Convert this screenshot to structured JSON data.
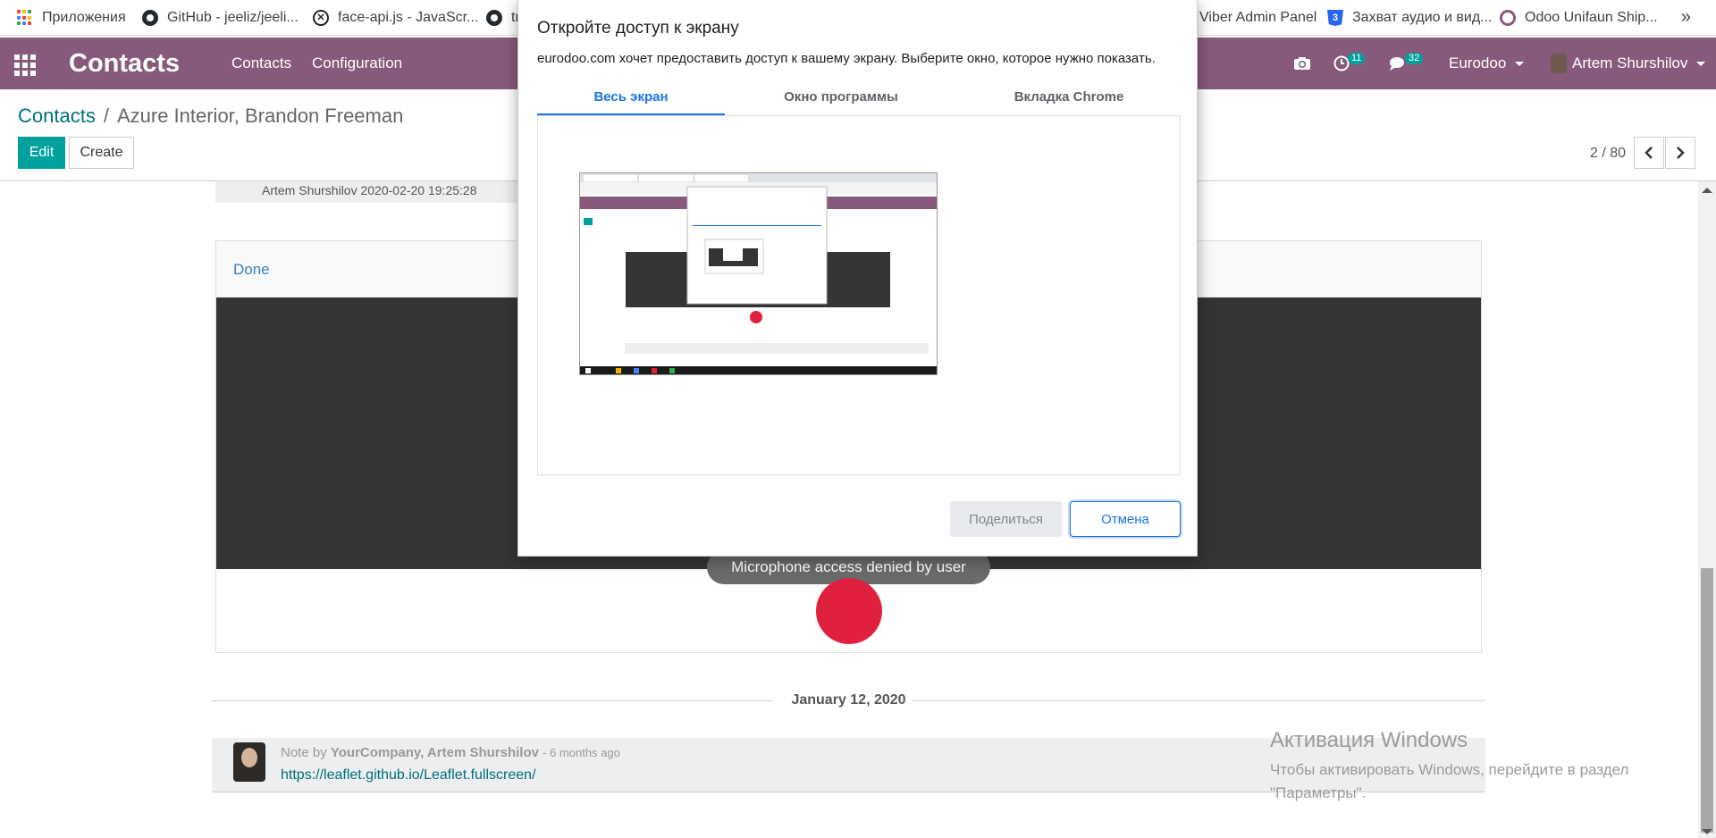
{
  "bookmarks": [
    {
      "label": "Приложения",
      "icon": "apps-grid-icon"
    },
    {
      "label": "GitHub - jeeliz/jeeli...",
      "icon": "github-icon"
    },
    {
      "label": "face-api.js - JavaScr...",
      "icon": "x-circle-icon"
    },
    {
      "label": "tr",
      "icon": "github-icon"
    },
    {
      "label": "Viber Admin Panel",
      "icon": ""
    },
    {
      "label": "Захват аудио и вид...",
      "icon": "css3-icon"
    },
    {
      "label": "Odoo Unifaun Ship...",
      "icon": "odoo-icon"
    }
  ],
  "bookmarks_more": "»",
  "navbar": {
    "brand": "Contacts",
    "menu": [
      "Contacts",
      "Configuration"
    ],
    "activity_count": "11",
    "messages_count": "32",
    "company": "Eurodoo",
    "user": "Artem Shurshilov"
  },
  "breadcrumb": {
    "parent": "Contacts",
    "separator": "/",
    "current": "Azure Interior, Brandon Freeman"
  },
  "controls": {
    "edit": "Edit",
    "create": "Create",
    "pager": "2 / 80"
  },
  "content": {
    "top_message_meta": "Artem Shurshilov 2020-02-20 19:25:28",
    "card_done": "Done",
    "toast": "Microphone access denied by user",
    "date_separator": "January 12, 2020",
    "note": {
      "prefix": "Note by",
      "authors": "YourCompany, Artem Shurshilov",
      "ago": "- 6 months ago",
      "link": "https://leaflet.github.io/Leaflet.fullscreen/"
    }
  },
  "share_dialog": {
    "title": "Откройте доступ к экрану",
    "description": "eurodoo.com хочет предоставить доступ к вашему экрану. Выберите окно, которое нужно показать.",
    "tabs": [
      "Весь экран",
      "Окно программы",
      "Вкладка Chrome"
    ],
    "active_tab": 0,
    "share_button": "Поделиться",
    "cancel_button": "Отмена"
  },
  "watermark": {
    "title": "Активация Windows",
    "line1": "Чтобы активировать Windows, перейдите в раздел",
    "line2": "\"Параметры\"."
  },
  "colors": {
    "odoo_purple": "#875a7b",
    "teal": "#00a09d",
    "chrome_blue": "#1a73e8",
    "record_red": "#e0203f"
  }
}
